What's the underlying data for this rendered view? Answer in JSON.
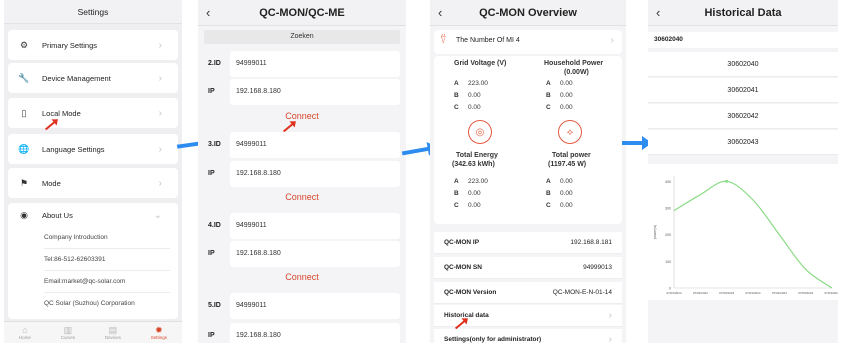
{
  "settings": {
    "title": "Settings",
    "items": [
      {
        "label": "Primary Settings",
        "icon": "gear-icon"
      },
      {
        "label": "Device Management",
        "icon": "wrench-icon"
      },
      {
        "label": "Local Mode",
        "icon": "phone-icon"
      },
      {
        "label": "Language Settings",
        "icon": "globe-icon"
      },
      {
        "label": "Mode",
        "icon": "flag-icon"
      },
      {
        "label": "About Us",
        "icon": "eye-icon"
      }
    ],
    "about_items": [
      "Company Introduction",
      "Tel:86-512-62603391",
      "Email:market@qc-solar.com",
      "QC Solar (Suzhou) Corporation"
    ],
    "tabs": [
      {
        "label": "Home",
        "icon": "home-icon"
      },
      {
        "label": "Curves",
        "icon": "chart-icon"
      },
      {
        "label": "Devices",
        "icon": "devices-icon"
      },
      {
        "label": "Settings",
        "icon": "settings-icon"
      }
    ]
  },
  "local": {
    "title": "QC-MON/QC-ME",
    "search_label": "Zoeken",
    "connect_label": "Connect",
    "devices": [
      {
        "id_label": "2.ID",
        "id": "94999011",
        "ip_label": "IP",
        "ip": "192.168.8.180"
      },
      {
        "id_label": "3.ID",
        "id": "94999011",
        "ip_label": "IP",
        "ip": "192.168.8.180"
      },
      {
        "id_label": "4.ID",
        "id": "94999011",
        "ip_label": "IP",
        "ip": "192.168.8.180"
      },
      {
        "id_label": "5.ID",
        "id": "94999011",
        "ip_label": "IP",
        "ip": "192.168.8.180"
      }
    ]
  },
  "overview": {
    "title": "QC-MON Overview",
    "mi_label": "The Number Of MI 4",
    "grid_voltage_label": "Grid Voltage (V)",
    "household_power_label": "Household Power",
    "household_power_value": "(0.00W)",
    "phase_a": "A",
    "phase_b": "B",
    "phase_c": "C",
    "grid_a": "223.00",
    "grid_b": "0.00",
    "grid_c": "0.00",
    "house_a": "0.00",
    "house_b": "0.00",
    "house_c": "0.00",
    "total_energy_label": "Total Energy",
    "total_energy_value": "(342.63 kWh)",
    "total_power_label": "Total power",
    "total_power_value": "(1197.45 W)",
    "energy_a": "223.00",
    "energy_b": "0.00",
    "energy_c": "0.00",
    "power_a": "0.00",
    "power_b": "0.00",
    "power_c": "0.00",
    "info": [
      {
        "label": "QC-MON IP",
        "value": "192.168.8.181"
      },
      {
        "label": "QC-MON SN",
        "value": "94999013"
      },
      {
        "label": "QC-MON Version",
        "value": "QC-MON-E-N-01-14"
      }
    ],
    "historical_label": "Historical data",
    "settings_admin_label": "Settings(only for administrator)"
  },
  "historical": {
    "title": "Historical Data",
    "selected": "30602040",
    "items": [
      "30602040",
      "30602041",
      "30602042",
      "30602043"
    ],
    "chart_data": {
      "type": "line",
      "x": [
        "07/03/2024",
        "07/03/2024",
        "07/03/2024",
        "07/03/2024",
        "07/03/2024",
        "07/03/2024",
        "07/03/2024"
      ],
      "series": [
        {
          "values": [
            290,
            350,
            400,
            330,
            200,
            70,
            -10
          ]
        }
      ],
      "ylabel": "power(w)",
      "yticks": [
        "400",
        "300",
        "200",
        "100",
        "0"
      ],
      "ylim": [
        0,
        420
      ],
      "color": "#8bdb84",
      "grid": false
    }
  }
}
